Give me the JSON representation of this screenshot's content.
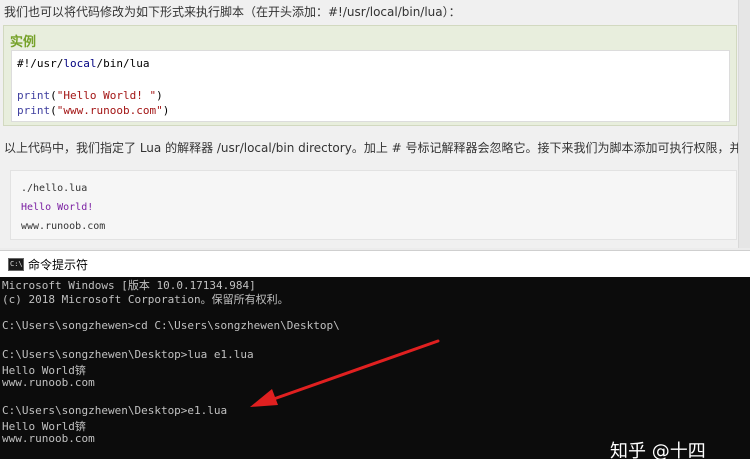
{
  "page": {
    "intro_text": "我们也可以将代码修改为如下形式来执行脚本（在开头添加：#!/usr/local/bin/lua）：",
    "example_title": "实例",
    "code": {
      "line1": {
        "prefix": "#!/usr/",
        "local": "local",
        "suffix": "/bin/lua"
      },
      "line2": {
        "fn": "print",
        "open": "(",
        "str": "\"Hello World! \"",
        "close": ")"
      },
      "line3": {
        "fn": "print",
        "open": "(",
        "str": "\"www.runoob.com\"",
        "close": ")"
      }
    },
    "after_text": "以上代码中，我们指定了 Lua 的解释器 /usr/local/bin directory。加上 # 号标记解释器会忽略它。接下来我们为脚本添加可执行权限，并执行：",
    "shell": {
      "cmd": "./hello.lua",
      "hello": "Hello World!",
      "url": "www.runoob.com"
    }
  },
  "console": {
    "title": "命令提示符",
    "icon_glyph": "C:\\",
    "lines": [
      "Microsoft Windows [版本 10.0.17134.984]",
      "(c) 2018 Microsoft Corporation。保留所有权利。",
      "",
      "C:\\Users\\songzhewen>cd C:\\Users\\songzhewen\\Desktop\\",
      "",
      "C:\\Users\\songzhewen\\Desktop>lua e1.lua",
      "Hello World锛",
      "www.runoob.com",
      "",
      "C:\\Users\\songzhewen\\Desktop>e1.lua",
      "Hello World锛",
      "www.runoob.com"
    ],
    "arrow_color": "#e02020"
  },
  "watermark": "知乎 @十四"
}
